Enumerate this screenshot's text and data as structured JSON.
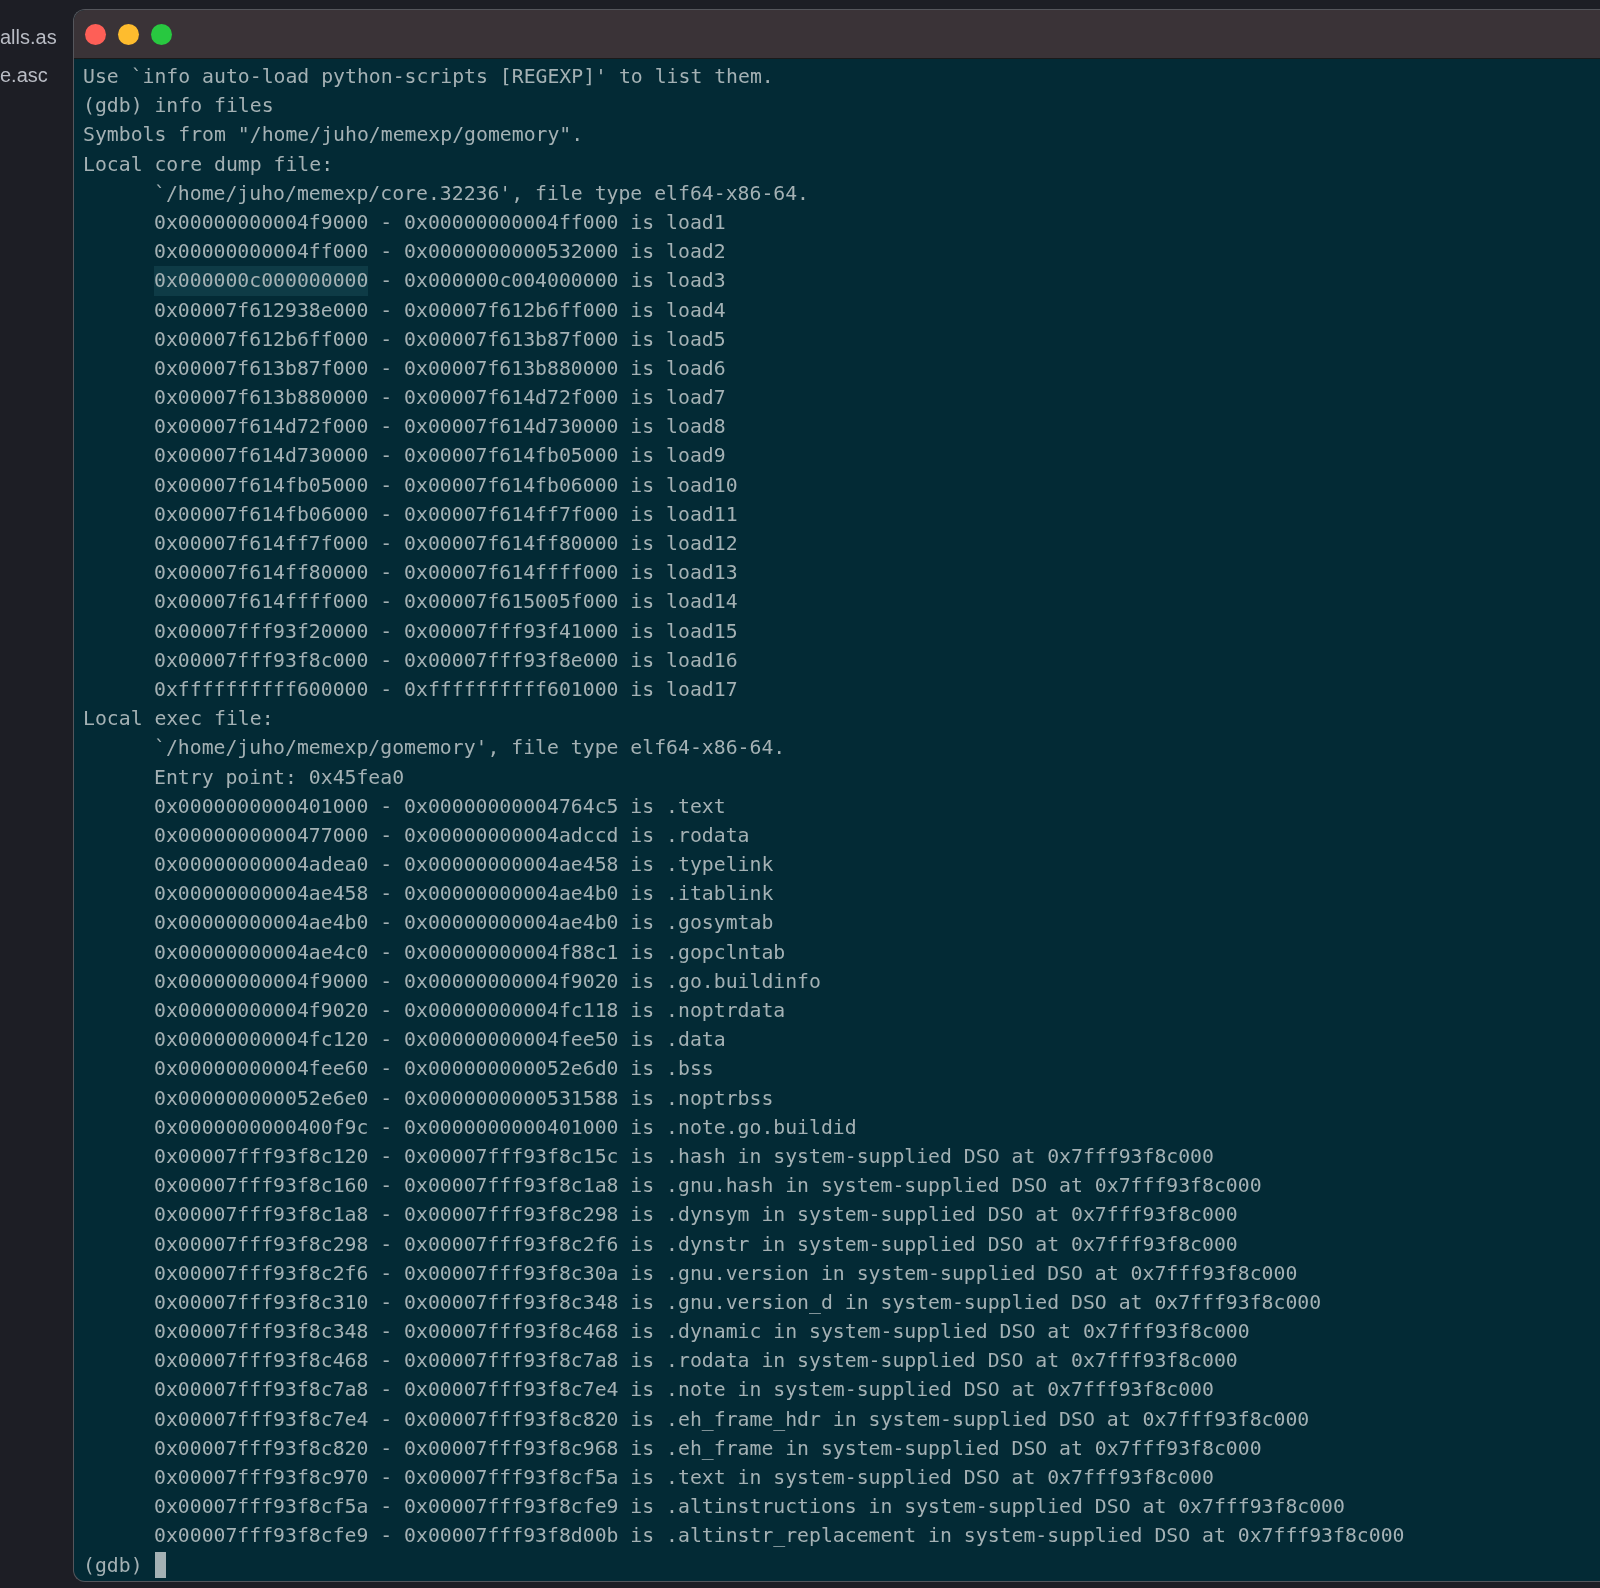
{
  "sidebar": {
    "items": [
      {
        "label": "alls.as"
      },
      {
        "label": "e.asc"
      }
    ]
  },
  "window": {
    "buttons": [
      {
        "kind": "close"
      },
      {
        "kind": "minimize"
      },
      {
        "kind": "zoom"
      }
    ]
  },
  "terminal": {
    "lines": [
      {
        "text": "Use `info auto-load python-scripts [REGEXP]' to list them."
      },
      {
        "text": "(gdb) info files"
      },
      {
        "text": "Symbols from \"/home/juho/memexp/gomemory\"."
      },
      {
        "text": "Local core dump file:",
        "children": [
          {
            "text": "`/home/juho/memexp/core.32236', file type elf64-x86-64."
          },
          {
            "text": "0x00000000004f9000 - 0x00000000004ff000 is load1"
          },
          {
            "text": "0x00000000004ff000 - 0x0000000000532000 is load2"
          },
          {
            "highlighted_text": "0x000000c000000000",
            "text": " - 0x000000c004000000 is load3"
          },
          {
            "text": "0x00007f612938e000 - 0x00007f612b6ff000 is load4"
          },
          {
            "text": "0x00007f612b6ff000 - 0x00007f613b87f000 is load5"
          },
          {
            "text": "0x00007f613b87f000 - 0x00007f613b880000 is load6"
          },
          {
            "text": "0x00007f613b880000 - 0x00007f614d72f000 is load7"
          },
          {
            "text": "0x00007f614d72f000 - 0x00007f614d730000 is load8"
          },
          {
            "text": "0x00007f614d730000 - 0x00007f614fb05000 is load9"
          },
          {
            "text": "0x00007f614fb05000 - 0x00007f614fb06000 is load10"
          },
          {
            "text": "0x00007f614fb06000 - 0x00007f614ff7f000 is load11"
          },
          {
            "text": "0x00007f614ff7f000 - 0x00007f614ff80000 is load12"
          },
          {
            "text": "0x00007f614ff80000 - 0x00007f614ffff000 is load13"
          },
          {
            "text": "0x00007f614ffff000 - 0x00007f615005f000 is load14"
          },
          {
            "text": "0x00007fff93f20000 - 0x00007fff93f41000 is load15"
          },
          {
            "text": "0x00007fff93f8c000 - 0x00007fff93f8e000 is load16"
          },
          {
            "text": "0xffffffffff600000 - 0xffffffffff601000 is load17"
          }
        ]
      },
      {
        "text": "Local exec file:",
        "children": [
          {
            "text": "`/home/juho/memexp/gomemory', file type elf64-x86-64."
          },
          {
            "text": "Entry point: 0x45fea0"
          },
          {
            "text": "0x0000000000401000 - 0x00000000004764c5 is .text"
          },
          {
            "text": "0x0000000000477000 - 0x00000000004adccd is .rodata"
          },
          {
            "text": "0x00000000004adea0 - 0x00000000004ae458 is .typelink"
          },
          {
            "text": "0x00000000004ae458 - 0x00000000004ae4b0 is .itablink"
          },
          {
            "text": "0x00000000004ae4b0 - 0x00000000004ae4b0 is .gosymtab"
          },
          {
            "text": "0x00000000004ae4c0 - 0x00000000004f88c1 is .gopclntab"
          },
          {
            "text": "0x00000000004f9000 - 0x00000000004f9020 is .go.buildinfo"
          },
          {
            "text": "0x00000000004f9020 - 0x00000000004fc118 is .noptrdata"
          },
          {
            "text": "0x00000000004fc120 - 0x00000000004fee50 is .data"
          },
          {
            "text": "0x00000000004fee60 - 0x000000000052e6d0 is .bss"
          },
          {
            "text": "0x000000000052e6e0 - 0x0000000000531588 is .noptrbss"
          },
          {
            "text": "0x0000000000400f9c - 0x0000000000401000 is .note.go.buildid"
          },
          {
            "text": "0x00007fff93f8c120 - 0x00007fff93f8c15c is .hash in system-supplied DSO at 0x7fff93f8c000"
          },
          {
            "text": "0x00007fff93f8c160 - 0x00007fff93f8c1a8 is .gnu.hash in system-supplied DSO at 0x7fff93f8c000"
          },
          {
            "text": "0x00007fff93f8c1a8 - 0x00007fff93f8c298 is .dynsym in system-supplied DSO at 0x7fff93f8c000"
          },
          {
            "text": "0x00007fff93f8c298 - 0x00007fff93f8c2f6 is .dynstr in system-supplied DSO at 0x7fff93f8c000"
          },
          {
            "text": "0x00007fff93f8c2f6 - 0x00007fff93f8c30a is .gnu.version in system-supplied DSO at 0x7fff93f8c000"
          },
          {
            "text": "0x00007fff93f8c310 - 0x00007fff93f8c348 is .gnu.version_d in system-supplied DSO at 0x7fff93f8c000"
          },
          {
            "text": "0x00007fff93f8c348 - 0x00007fff93f8c468 is .dynamic in system-supplied DSO at 0x7fff93f8c000"
          },
          {
            "text": "0x00007fff93f8c468 - 0x00007fff93f8c7a8 is .rodata in system-supplied DSO at 0x7fff93f8c000"
          },
          {
            "text": "0x00007fff93f8c7a8 - 0x00007fff93f8c7e4 is .note in system-supplied DSO at 0x7fff93f8c000"
          },
          {
            "text": "0x00007fff93f8c7e4 - 0x00007fff93f8c820 is .eh_frame_hdr in system-supplied DSO at 0x7fff93f8c000"
          },
          {
            "text": "0x00007fff93f8c820 - 0x00007fff93f8c968 is .eh_frame in system-supplied DSO at 0x7fff93f8c000"
          },
          {
            "text": "0x00007fff93f8c970 - 0x00007fff93f8cf5a is .text in system-supplied DSO at 0x7fff93f8c000"
          },
          {
            "text": "0x00007fff93f8cf5a - 0x00007fff93f8cfe9 is .altinstructions in system-supplied DSO at 0x7fff93f8c000"
          },
          {
            "text": "0x00007fff93f8cfe9 - 0x00007fff93f8d00b is .altinstr_replacement in system-supplied DSO at 0x7fff93f8c000"
          }
        ]
      }
    ],
    "prompt": {
      "text": "(gdb)",
      "cursor": true
    }
  }
}
